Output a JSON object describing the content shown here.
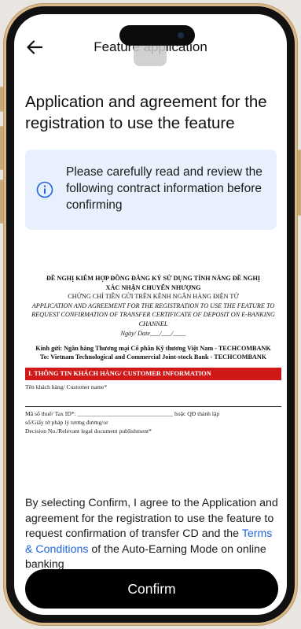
{
  "header": {
    "back_icon": "arrow-left-icon",
    "title": "Feature application"
  },
  "page_title": "Application and agreement for the registration to use the feature",
  "notice": {
    "icon": "info-icon",
    "accent": "#1f64d8",
    "background": "#e7f0fc",
    "text": "Please carefully read and review the following contract information before confirming"
  },
  "document": {
    "heading_vi_1": "ĐỀ NGHỊ KIÊM HỢP ĐỒNG ĐĂNG KÝ SỬ DỤNG TÍNH NĂNG ĐỀ NGHỊ",
    "heading_vi_2": "XÁC NHẬN CHUYỂN NHƯỢNG",
    "heading_vi_3": "CHỨNG CHỈ TIỀN GỬI TRÊN KÊNH NGÂN HÀNG ĐIỆN TỬ",
    "heading_en": "APPLICATION AND AGREEMENT FOR THE REGISTRATION TO USE THE FEATURE TO REQUEST CONFIRMATION OF TRANSFER CERTIFICATE OF DEPOSIT ON E-BANKING CHANNEL",
    "date": "Ngày/ Date___/___/____",
    "to_vi": "Kính gửi: Ngân hàng Thương mại Cổ phần Kỹ thương Việt Nam - TECHCOMBANK",
    "to_en": "To: Vietnam Technological and Commercial Joint-stock Bank - TECHCOMBANK",
    "section_title": "I. THÔNG TIN KHÁCH HÀNG/ CUSTOMER INFORMATION",
    "field_name": "Tên khách hàng/ Customer name*",
    "field_tax": "Mã số thuế/ Tax ID*: ________________________________ hoặc QĐ thành lập",
    "field_tax_2": "số/Giấy tờ pháp lý tương đương/or",
    "field_decision": "Decision No./Relevant legal document publishment*"
  },
  "agreement": {
    "text_before": "By selecting Confirm, I agree to the Application and agreement for the registration to use the feature to request confirmation of transfer CD and the ",
    "link_text": "Terms & Conditions",
    "text_after": " of the Auto-Earning Mode on online banking",
    "link_color": "#1f64d8"
  },
  "confirm_button": "Confirm"
}
